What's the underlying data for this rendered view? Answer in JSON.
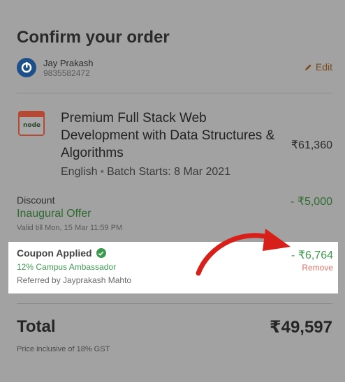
{
  "header": {
    "title": "Confirm your order"
  },
  "user": {
    "name": "Jay Prakash",
    "phone": "9835582472",
    "edit_label": "Edit"
  },
  "course": {
    "title": "Premium Full Stack Web Development with Data Structures & Algorithms",
    "language": "English",
    "batch": "Batch Starts: 8 Mar 2021",
    "price": "₹61,360",
    "icon_label": "node"
  },
  "discount": {
    "label": "Discount",
    "name": "Inaugural Offer",
    "validity": "Valid till Mon, 15 Mar 11:59 PM",
    "amount": "- ₹5,000"
  },
  "coupon": {
    "label": "Coupon Applied",
    "name": "12% Campus Ambassador",
    "referred_by": "Referred by Jayprakash Mahto",
    "amount": "- ₹6,764",
    "remove_label": "Remove"
  },
  "total": {
    "label": "Total",
    "amount": "₹49,597",
    "note": "Price inclusive of 18% GST"
  },
  "colors": {
    "overlay": "#a2a2a2",
    "discount_green": "#2e6b2e",
    "coupon_green": "#3c9a4e",
    "remove_red": "#e0706b",
    "arrow_red": "#d8201a"
  }
}
